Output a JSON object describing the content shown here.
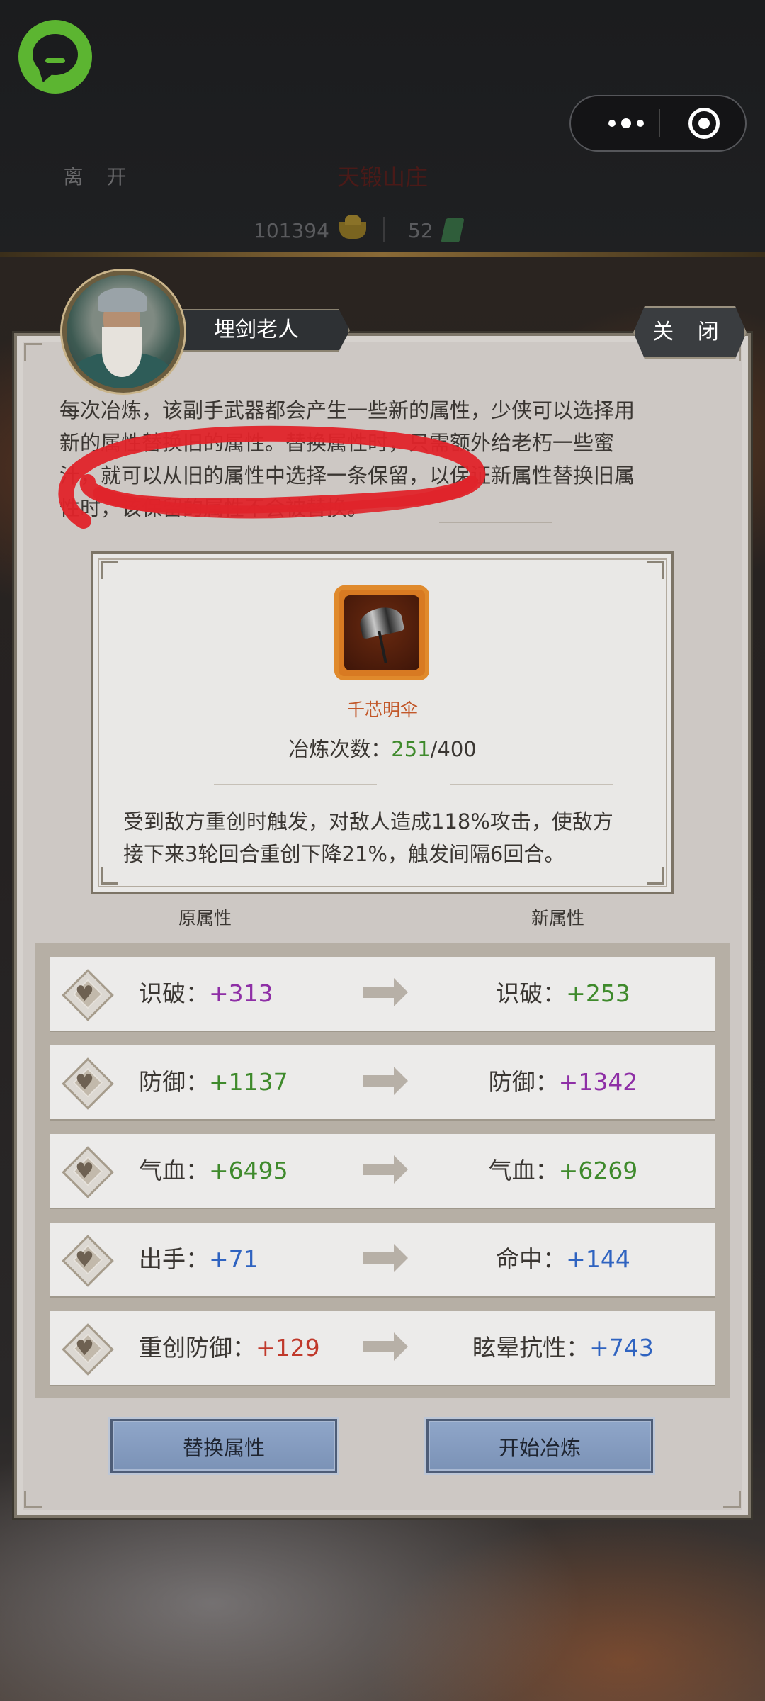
{
  "topbar": {
    "leave_label": "离 开",
    "location_title": "天锻山庄",
    "gold": "101394",
    "jade": "52"
  },
  "npc": {
    "name": "埋剑老人",
    "close_label": "关 闭"
  },
  "description": [
    "每次冶炼，该副手武器都会产生一些新的属性，少侠可以选择用",
    "新的属性替换旧的属性。替换属性时，只需额外给老朽一些蜜",
    "汁，就可以从旧的属性中选择一条保留，以保证新属性替换旧属",
    "性时，该保留的属性不会被替换。"
  ],
  "item": {
    "name": "千芯明伞",
    "refine_label": "冶炼次数：",
    "refine_current": "251",
    "refine_max": "/400",
    "effect": [
      "受到敌方重创时触发，对敌人造成118%攻击，使敌方",
      "接下来3轮回合重创下降21%，触发间隔6回合。"
    ]
  },
  "columns": {
    "old": "原属性",
    "new": "新属性"
  },
  "attributes": [
    {
      "old_label": "识破：",
      "old_value": "+313",
      "old_color": "#8e2fa6",
      "new_label": "识破：",
      "new_value": "+253",
      "new_color": "#3f8a2c"
    },
    {
      "old_label": "防御：",
      "old_value": "+1137",
      "old_color": "#3f8a2c",
      "new_label": "防御：",
      "new_value": "+1342",
      "new_color": "#8e2fa6"
    },
    {
      "old_label": "气血：",
      "old_value": "+6495",
      "old_color": "#3f8a2c",
      "new_label": "气血：",
      "new_value": "+6269",
      "new_color": "#3f8a2c"
    },
    {
      "old_label": "出手：",
      "old_value": "+71",
      "old_color": "#2f63c0",
      "new_label": "命中：",
      "new_value": "+144",
      "new_color": "#2f63c0"
    },
    {
      "old_label": "重创防御：",
      "old_value": "+129",
      "old_color": "#c0392b",
      "new_label": "眩晕抗性：",
      "new_value": "+743",
      "new_color": "#2f63c0"
    }
  ],
  "actions": {
    "replace_label": "替换属性",
    "refine_label": "开始冶炼"
  },
  "annotation_color": "#e0242a"
}
